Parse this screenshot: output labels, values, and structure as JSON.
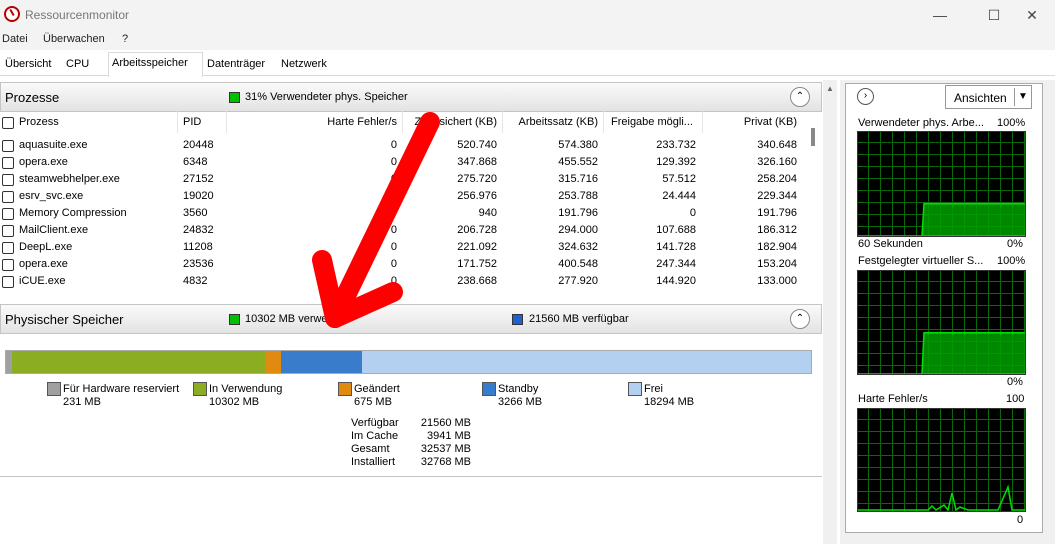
{
  "window": {
    "title": "Ressourcenmonitor",
    "minimize": "—",
    "maximize": "☐",
    "close": "✕"
  },
  "menu": [
    "Datei",
    "Überwachen",
    "?"
  ],
  "tabs": [
    "Übersicht",
    "CPU",
    "Arbeitsspeicher",
    "Datenträger",
    "Netzwerk"
  ],
  "active_tab": "Arbeitsspeicher",
  "processes": {
    "title": "Prozesse",
    "indicator": "31% Verwendeter phys. Speicher",
    "indicator_color": "#00c000",
    "columns": [
      "Prozess",
      "PID",
      "Harte Fehler/s",
      "Zugesichert (KB)",
      "Arbeitssatz (KB)",
      "Freigabe mögli...",
      "Privat (KB)"
    ],
    "rows": [
      [
        "aquasuite.exe",
        "20448",
        "0",
        "520.740",
        "574.380",
        "233.732",
        "340.648"
      ],
      [
        "opera.exe",
        "6348",
        "0",
        "347.868",
        "455.552",
        "129.392",
        "326.160"
      ],
      [
        "steamwebhelper.exe",
        "27152",
        "0",
        "275.720",
        "315.716",
        "57.512",
        "258.204"
      ],
      [
        "esrv_svc.exe",
        "19020",
        "0",
        "256.976",
        "253.788",
        "24.444",
        "229.344"
      ],
      [
        "Memory Compression",
        "3560",
        "0",
        "940",
        "191.796",
        "0",
        "191.796"
      ],
      [
        "MailClient.exe",
        "24832",
        "0",
        "206.728",
        "294.000",
        "107.688",
        "186.312"
      ],
      [
        "DeepL.exe",
        "11208",
        "0",
        "221.092",
        "324.632",
        "141.728",
        "182.904"
      ],
      [
        "opera.exe",
        "23536",
        "0",
        "171.752",
        "400.548",
        "247.344",
        "153.204"
      ],
      [
        "iCUE.exe",
        "4832",
        "0",
        "238.668",
        "277.920",
        "144.920",
        "133.000"
      ]
    ]
  },
  "physical_memory": {
    "title": "Physischer Speicher",
    "in_use_indicator": "10302 MB verwendet",
    "in_use_color": "#00c000",
    "available_indicator": "21560 MB verfügbar",
    "available_color": "#2060d0",
    "bar_segments": [
      {
        "label": "Für Hardware reserviert",
        "value": "231 MB",
        "mb": 231,
        "color": "#a0a0a0"
      },
      {
        "label": "In Verwendung",
        "value": "10302 MB",
        "mb": 10302,
        "color": "#8aad21"
      },
      {
        "label": "Geändert",
        "value": "675 MB",
        "mb": 675,
        "color": "#e08a10"
      },
      {
        "label": "Standby",
        "value": "3266 MB",
        "mb": 3266,
        "color": "#3a7ccc"
      },
      {
        "label": "Frei",
        "value": "18294 MB",
        "mb": 18294,
        "color": "#b4d0f0"
      }
    ],
    "summary": [
      {
        "label": "Verfügbar",
        "value": "21560 MB"
      },
      {
        "label": "Im Cache",
        "value": "3941 MB"
      },
      {
        "label": "Gesamt",
        "value": "32537 MB"
      },
      {
        "label": "Installiert",
        "value": "32768 MB"
      }
    ]
  },
  "right_panel": {
    "expand_icon": "›",
    "view_button": "Ansichten",
    "graphs": [
      {
        "title": "Verwendeter phys. Arbe...",
        "max": "100%",
        "footer_left": "60 Sekunden",
        "footer_right": "0%",
        "level": 0.31
      },
      {
        "title": "Festgelegter virtueller S...",
        "max": "100%",
        "footer_left": "",
        "footer_right": "0%",
        "level": 0.4
      },
      {
        "title": "Harte Fehler/s",
        "max": "100",
        "footer_left": "",
        "footer_right": "0",
        "level": 0.05
      }
    ]
  },
  "colors": {
    "graph_bg": "#000000",
    "graph_grid": "#0a6a0a",
    "graph_line": "#00e000",
    "annotation_arrow": "#ff0000"
  }
}
